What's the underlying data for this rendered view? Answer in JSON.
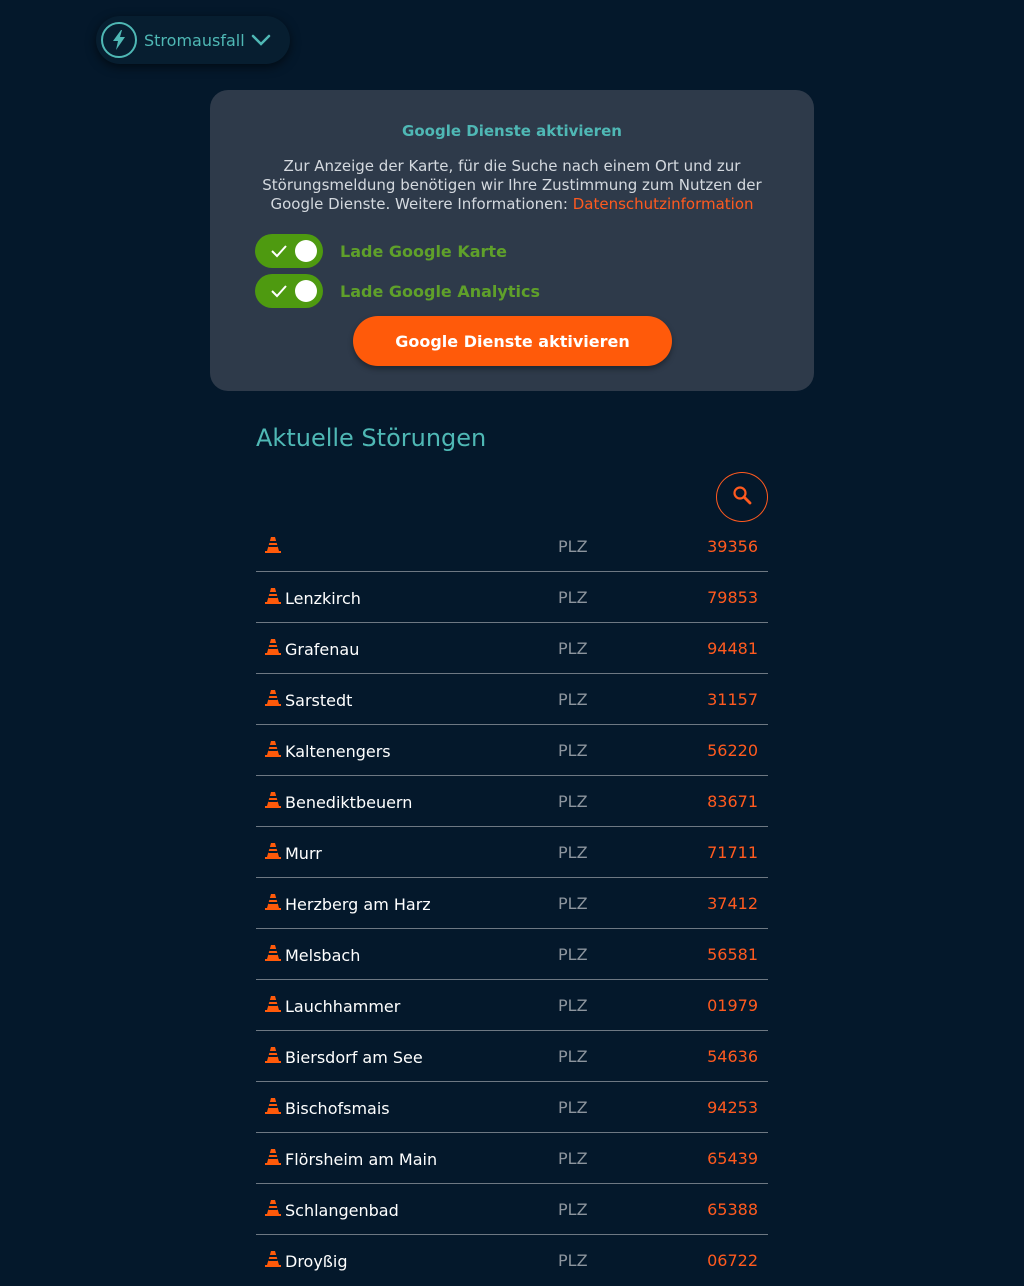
{
  "header": {
    "service_label": "Stromausfall",
    "service_icon": "lightning-bolt-icon"
  },
  "consent": {
    "title": "Google Dienste aktivieren",
    "text": "Zur Anzeige der Karte, für die Suche nach einem Ort und zur Störungsmeldung benötigen wir Ihre Zustimmung zum Nutzen der Google Dienste. Weitere Informationen:",
    "privacy_link": "Datenschutzinformation",
    "toggle_map_label": "Lade Google Karte",
    "toggle_analytics_label": "Lade Google Analytics",
    "toggle_map_on": true,
    "toggle_analytics_on": true,
    "button_label": "Google Dienste aktivieren"
  },
  "outages": {
    "title": "Aktuelle Störungen",
    "plz_label": "PLZ",
    "rows": [
      {
        "city": "",
        "plz": "39356"
      },
      {
        "city": "Lenzkirch",
        "plz": "79853"
      },
      {
        "city": "Grafenau",
        "plz": "94481"
      },
      {
        "city": "Sarstedt",
        "plz": "31157"
      },
      {
        "city": "Kaltenengers",
        "plz": "56220"
      },
      {
        "city": "Benediktbeuern",
        "plz": "83671"
      },
      {
        "city": "Murr",
        "plz": "71711"
      },
      {
        "city": "Herzberg am Harz",
        "plz": "37412"
      },
      {
        "city": "Melsbach",
        "plz": "56581"
      },
      {
        "city": "Lauchhammer",
        "plz": "01979"
      },
      {
        "city": "Biersdorf am See",
        "plz": "54636"
      },
      {
        "city": "Bischofsmais",
        "plz": "94253"
      },
      {
        "city": "Flörsheim am Main",
        "plz": "65439"
      },
      {
        "city": "Schlangenbad",
        "plz": "65388"
      },
      {
        "city": "Droyßig",
        "plz": "06722"
      }
    ]
  },
  "colors": {
    "background": "#04182b",
    "accent_teal": "#4fb8b5",
    "accent_orange": "#ff5a1f",
    "toggle_green": "#4e9a10",
    "panel": "#2e3a4a"
  }
}
